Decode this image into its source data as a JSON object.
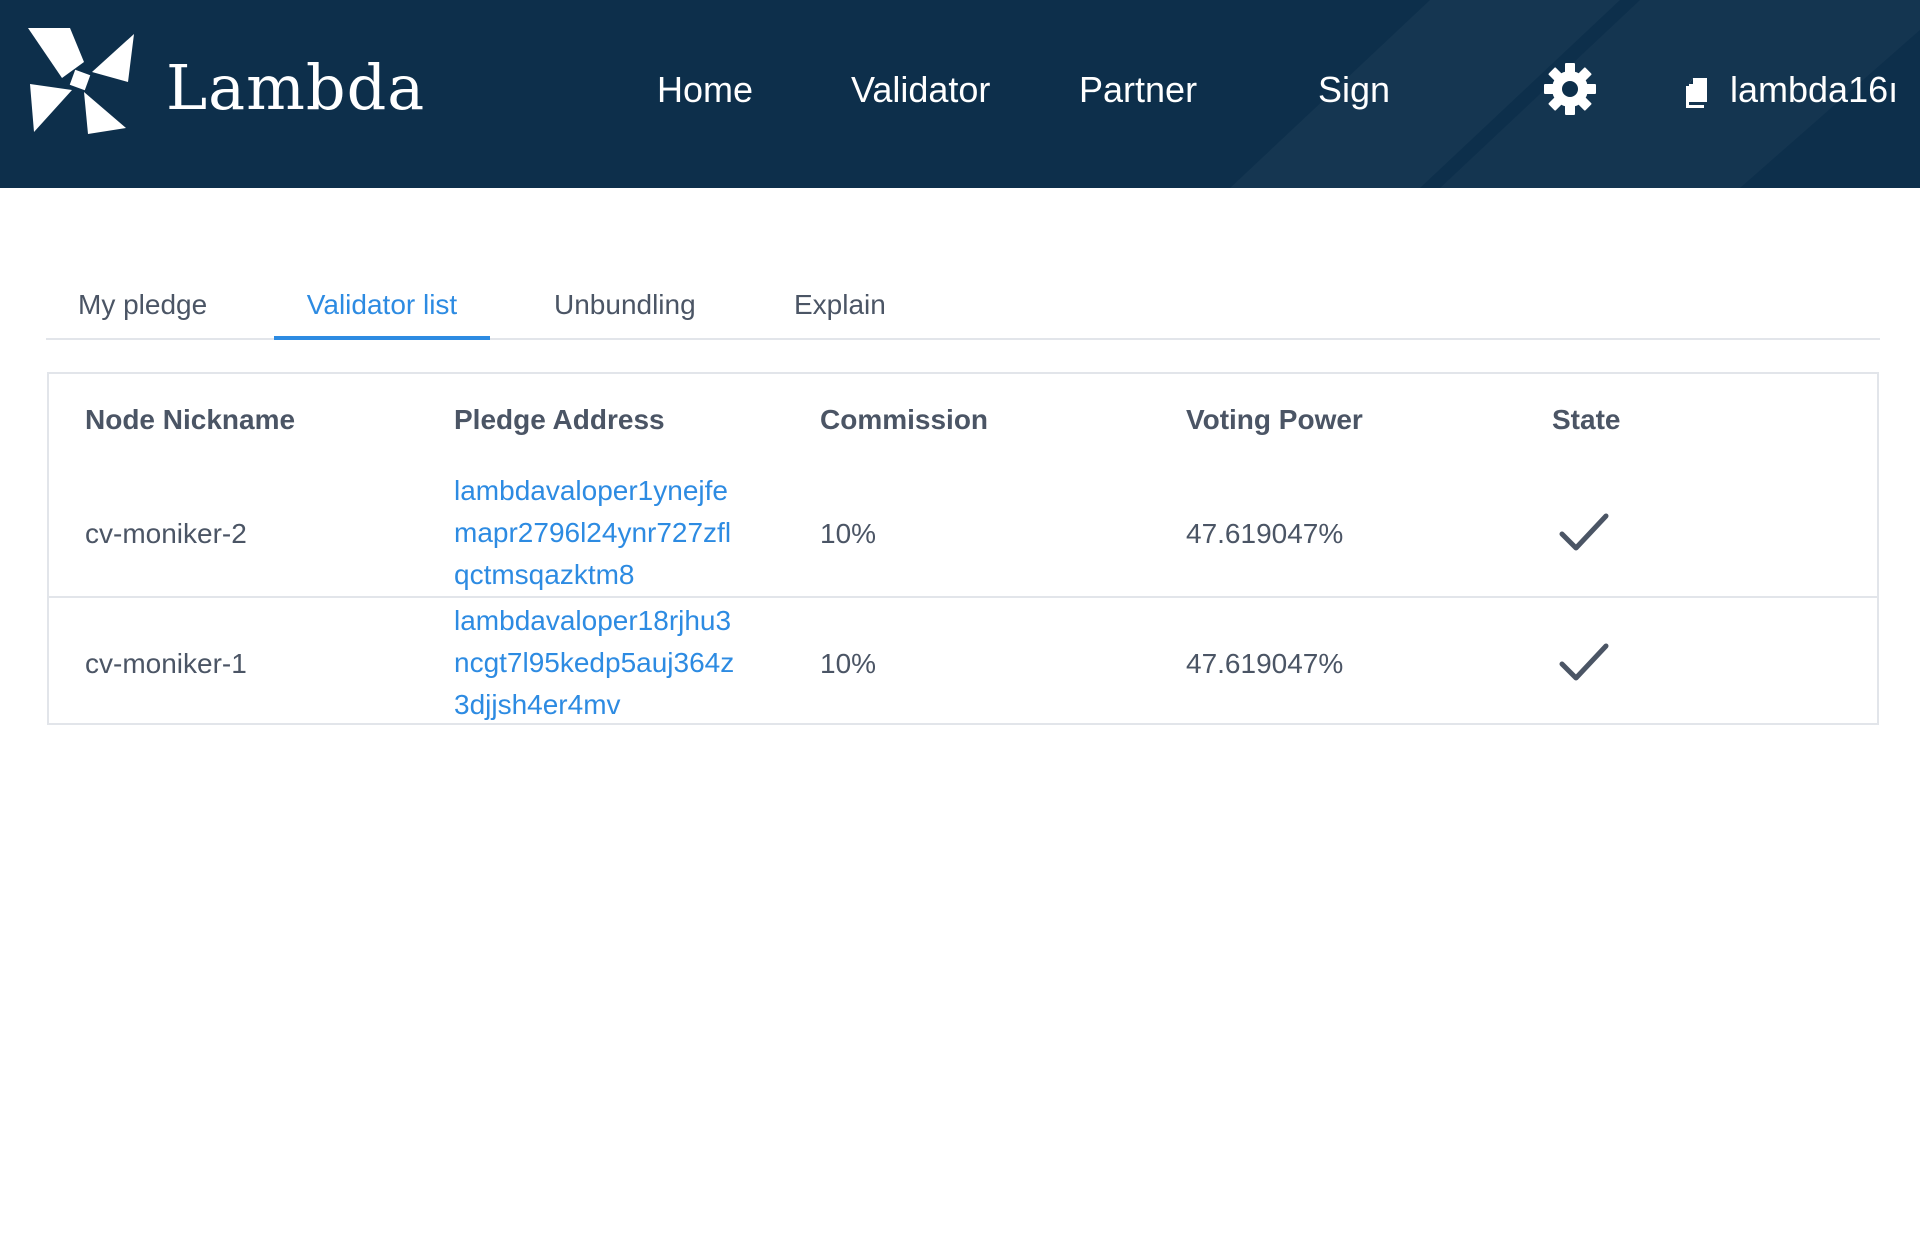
{
  "header": {
    "brand": "Lambda",
    "nav": {
      "home": "Home",
      "validator": "Validator",
      "partner": "Partner",
      "sign": "Sign"
    },
    "account_label": "lambda16ı"
  },
  "tabs": [
    {
      "label": "My pledge",
      "active": false
    },
    {
      "label": "Validator list",
      "active": true
    },
    {
      "label": "Unbundling",
      "active": false
    },
    {
      "label": "Explain",
      "active": false
    }
  ],
  "table": {
    "columns": [
      "Node Nickname",
      "Pledge Address",
      "Commission",
      "Voting Power",
      "State"
    ],
    "rows": [
      {
        "nickname": "cv-moniker-2",
        "address_lines": [
          "lambdavaloper1ynejfe",
          "mapr2796l24ynr727zfl",
          "qctmsqazktm8"
        ],
        "commission": "10%",
        "voting_power": "47.619047%",
        "state_icon": "check-icon"
      },
      {
        "nickname": "cv-moniker-1",
        "address_lines": [
          "lambdavaloper18rjhu3",
          "ncgt7l95kedp5auj364z",
          "3djjsh4er4mv"
        ],
        "commission": "10%",
        "voting_power": "47.619047%",
        "state_icon": "check-icon"
      }
    ]
  },
  "colors": {
    "header_bg": "#0d2f4b",
    "accent": "#2d8be2",
    "text": "#4b5565",
    "border": "#e2e5ea"
  }
}
